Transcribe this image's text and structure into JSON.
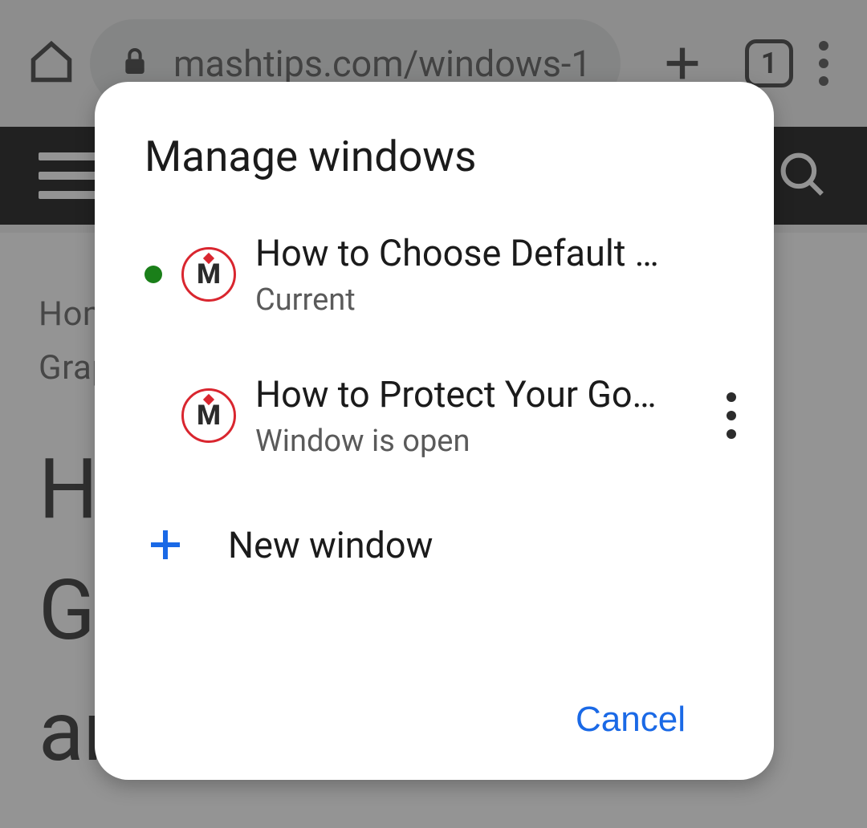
{
  "browser": {
    "url_display": "mashtips.com/windows-1",
    "tab_count": "1"
  },
  "page": {
    "breadcrumb_line1": "Hom",
    "breadcrumb_line2": "Grap",
    "title_line1": "H",
    "title_line2": "G",
    "title_line3": "ar"
  },
  "dialog": {
    "title": "Manage windows",
    "windows": [
      {
        "title": "How to Choose Default …",
        "subtitle": "Current",
        "is_current": true,
        "has_menu": false
      },
      {
        "title": "How to Protect Your Go…",
        "subtitle": "Window is open",
        "is_current": false,
        "has_menu": true
      }
    ],
    "new_window_label": "New window",
    "cancel_label": "Cancel"
  },
  "colors": {
    "accent_blue": "#1a69e6",
    "current_dot": "#1a7f19",
    "favicon_ring": "#d9262f"
  }
}
